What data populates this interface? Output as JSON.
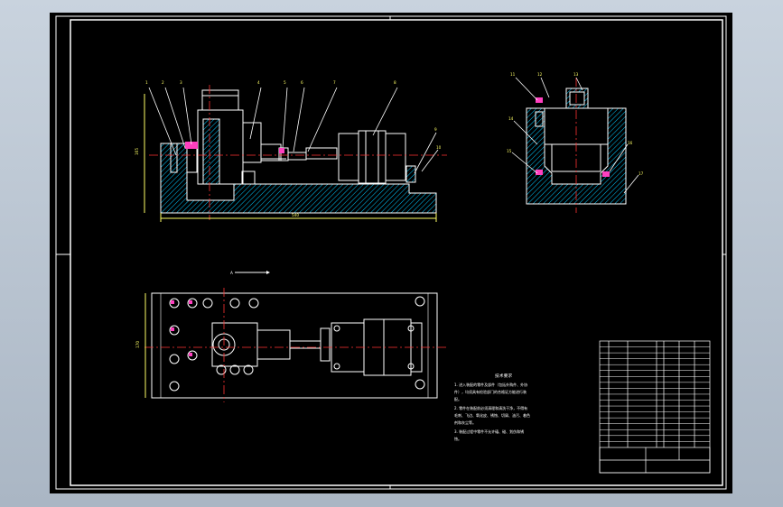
{
  "tech_requirements": {
    "title": "技术要求",
    "lines": [
      "1. 进入装配的零件及部件（包括外购件、外协",
      "件），均须具有检验部门的合格证方能进行装",
      "配。",
      "2. 零件在装配前必须清理和清洗干净，不得有",
      "毛刺、飞边、氧化皮、锈蚀、切屑、油污、着色",
      "剂和灰尘等。",
      "3. 装配过程中零件不允许磕、碰、划伤和锈",
      "蚀。"
    ]
  },
  "front_view": {
    "balloons": [
      "1",
      "2",
      "3",
      "4",
      "5",
      "6",
      "7",
      "8",
      "9",
      "10"
    ],
    "dim_length": "540",
    "dim_height": "165"
  },
  "side_view": {
    "balloons": [
      "11",
      "12",
      "13",
      "14",
      "15",
      "16",
      "17"
    ]
  },
  "top_view": {
    "section_label": "A",
    "dim_width": "170"
  },
  "colors": {
    "background": "#000000",
    "lines": "#ffffff",
    "dimension": "#ffff66",
    "center_line": "#ff3333",
    "hatch": "#00c8ff",
    "highlight": "#ff3fbf"
  }
}
